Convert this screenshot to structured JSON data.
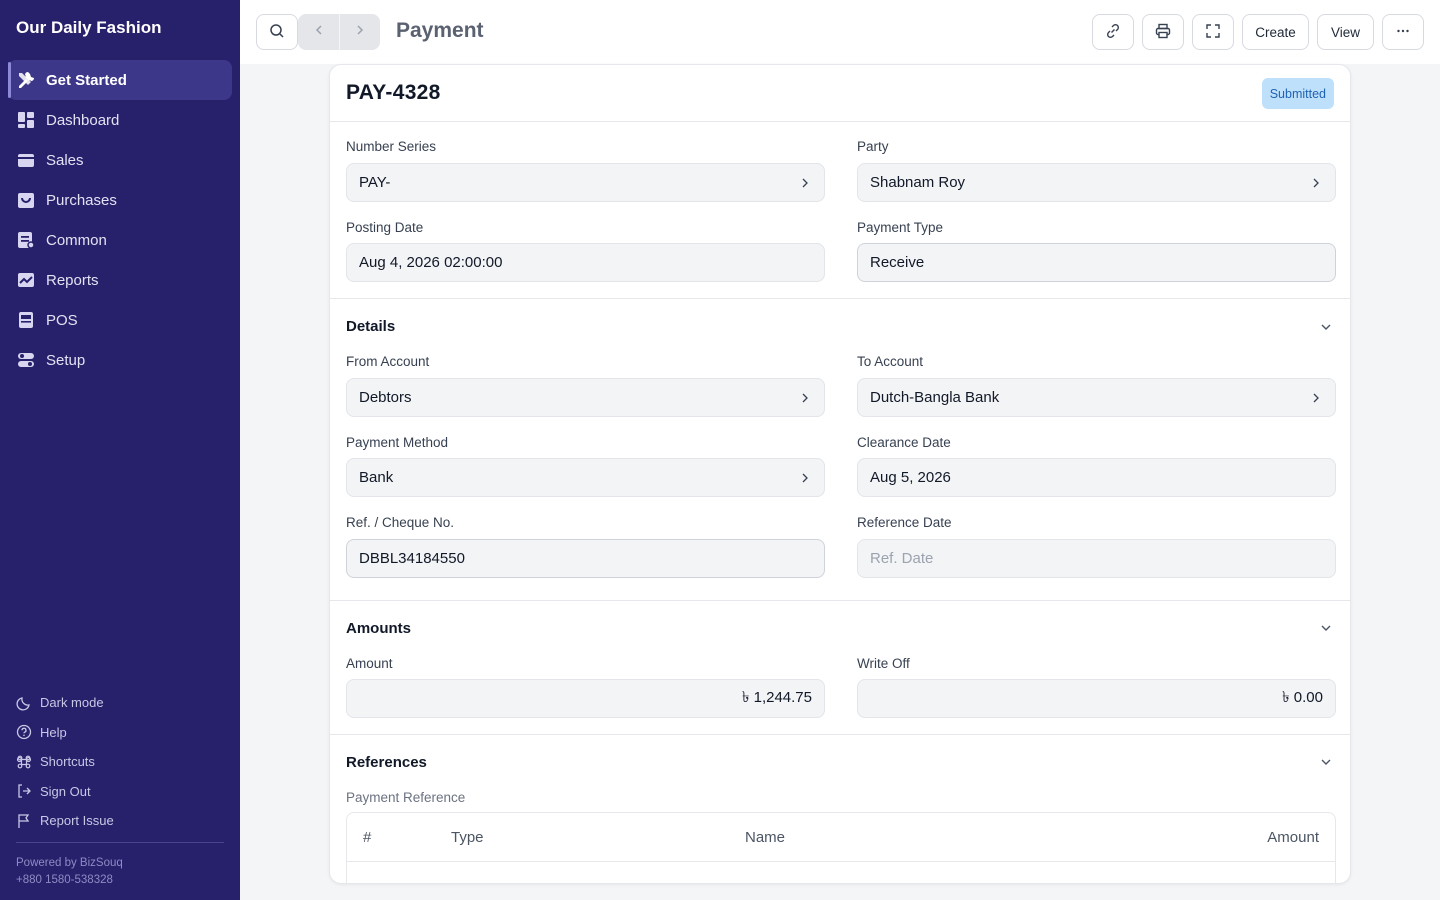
{
  "sidebar": {
    "brand": "Our Daily Fashion",
    "items": [
      {
        "label": "Get Started",
        "icon": "tools-icon"
      },
      {
        "label": "Dashboard",
        "icon": "dashboard-icon"
      },
      {
        "label": "Sales",
        "icon": "sales-icon"
      },
      {
        "label": "Purchases",
        "icon": "purchases-icon"
      },
      {
        "label": "Common",
        "icon": "common-icon"
      },
      {
        "label": "Reports",
        "icon": "reports-icon"
      },
      {
        "label": "POS",
        "icon": "pos-icon"
      },
      {
        "label": "Setup",
        "icon": "setup-icon"
      }
    ],
    "footer": [
      {
        "label": "Dark mode",
        "icon": "moon-icon"
      },
      {
        "label": "Help",
        "icon": "help-icon"
      },
      {
        "label": "Shortcuts",
        "icon": "command-icon"
      },
      {
        "label": "Sign Out",
        "icon": "sign-out-icon"
      },
      {
        "label": "Report Issue",
        "icon": "flag-icon"
      }
    ],
    "powered_by": "Powered by BizSouq",
    "phone": "+880 1580-538328"
  },
  "topbar": {
    "title": "Payment",
    "create_label": "Create",
    "view_label": "View"
  },
  "doc": {
    "name": "PAY-4328",
    "status": "Submitted",
    "fields": {
      "number_series": {
        "label": "Number Series",
        "value": "PAY-"
      },
      "party": {
        "label": "Party",
        "value": "Shabnam Roy"
      },
      "posting_date": {
        "label": "Posting Date",
        "value": "Aug 4, 2026 02:00:00"
      },
      "payment_type": {
        "label": "Payment Type",
        "value": "Receive"
      }
    }
  },
  "details": {
    "title": "Details",
    "from_account": {
      "label": "From Account",
      "value": "Debtors"
    },
    "to_account": {
      "label": "To Account",
      "value": "Dutch-Bangla Bank"
    },
    "payment_method": {
      "label": "Payment Method",
      "value": "Bank"
    },
    "clearance_date": {
      "label": "Clearance Date",
      "value": "Aug 5, 2026"
    },
    "ref_no": {
      "label": "Ref. / Cheque No.",
      "value": "DBBL34184550"
    },
    "reference_date": {
      "label": "Reference Date",
      "placeholder": "Ref. Date"
    }
  },
  "amounts": {
    "title": "Amounts",
    "amount": {
      "label": "Amount",
      "value": "৳ 1,244.75"
    },
    "write_off": {
      "label": "Write Off",
      "value": "৳ 0.00"
    }
  },
  "references": {
    "title": "References",
    "table_label": "Payment Reference",
    "columns": [
      "#",
      "Type",
      "Name",
      "Amount"
    ]
  },
  "colors": {
    "sidebar_bg": "#27206b",
    "active_item_bg": "#3d378a",
    "badge_bg": "#bfe0fb",
    "badge_text": "#1e63b3"
  }
}
